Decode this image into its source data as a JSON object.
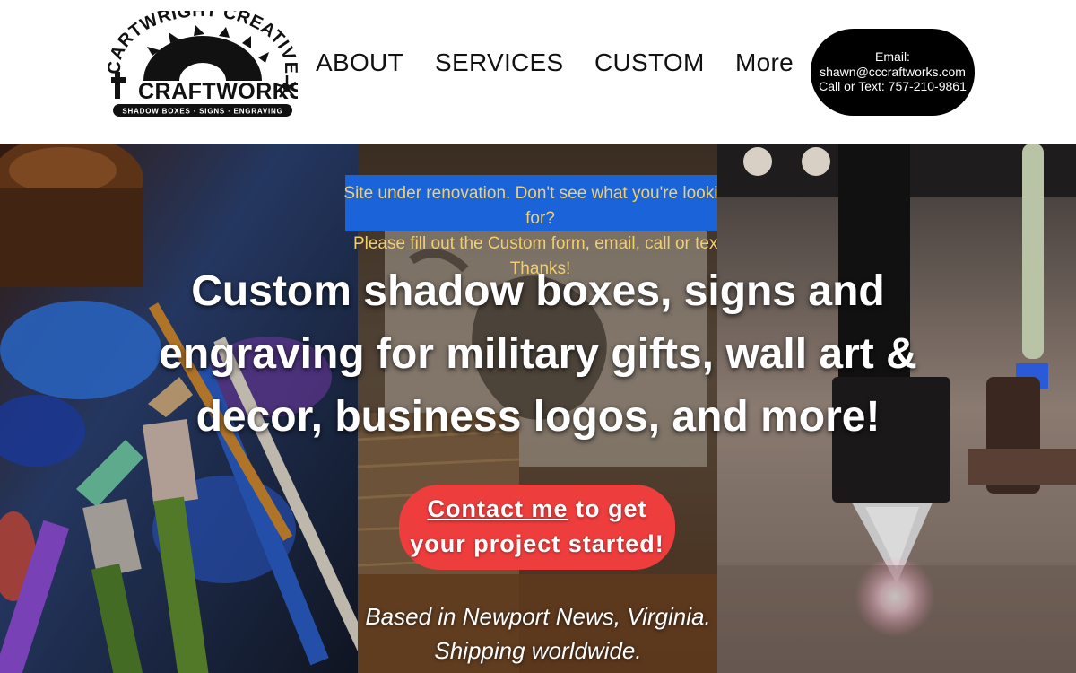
{
  "brand": {
    "logo_arc_text": "CARTWRIGHT CREATIVE",
    "logo_main_text": "CRAFTWORKS",
    "logo_sub_text": "SHADOW BOXES · SIGNS · ENGRAVING"
  },
  "nav": {
    "items": [
      {
        "label": "ABOUT"
      },
      {
        "label": "SERVICES"
      },
      {
        "label": "CUSTOM"
      },
      {
        "label": "More"
      }
    ]
  },
  "contact": {
    "email_label": "Email:",
    "email": "shawn@cccraftworks.com",
    "phone_prefix": "Call or Text: ",
    "phone": "757-210-9861"
  },
  "hero": {
    "notice_line1": "Site under renovation. Don't see what you're looking for?",
    "notice_line2": "Please fill out the Custom form, email, call or text. Thanks!",
    "headline": "Custom shadow boxes, signs and engraving for military gifts, wall art & decor, business logos, and more!",
    "cta_link": "Contact me",
    "cta_rest": " to get your project started!",
    "tagline_line1": "Based in Newport News, Virginia.",
    "tagline_line2": "Shipping worldwide."
  },
  "colors": {
    "contact_pill": "#000000",
    "notice_box": "#1a63d8",
    "notice_text": "#f0cf6e",
    "cta_button": "#ee3d3d"
  }
}
